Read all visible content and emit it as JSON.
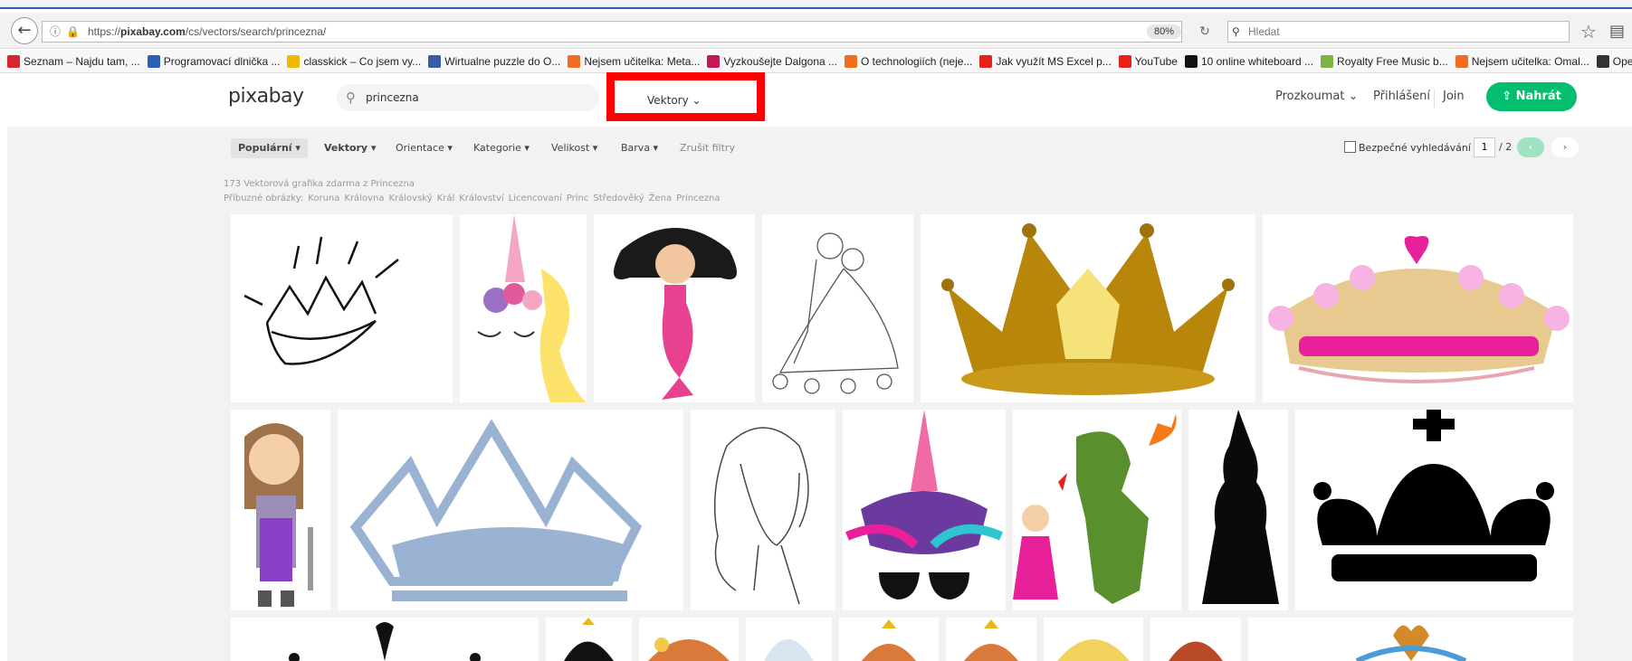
{
  "browser": {
    "url_prefix": "https://",
    "url_domain": "pixabay.com",
    "url_path": "/cs/vectors/search/princezna/",
    "zoom": "80%",
    "search_placeholder": "Hledat"
  },
  "bookmarks": [
    {
      "label": "Seznam – Najdu tam, ...",
      "color": "#d9232e"
    },
    {
      "label": "Programovací dlnička ...",
      "color": "#2b5fb4"
    },
    {
      "label": "classkick – Co jsem vy...",
      "color": "#f2b705"
    },
    {
      "label": "Wirtualne puzzle do O...",
      "color": "#3a5da8"
    },
    {
      "label": "Nejsem učitelka: Meta...",
      "color": "#f36d21"
    },
    {
      "label": "Vyzkoušejte Dalgona ...",
      "color": "#c2185b"
    },
    {
      "label": "O technologiích (neje...",
      "color": "#f36d21"
    },
    {
      "label": "Jak využít MS Excel p...",
      "color": "#e62117"
    },
    {
      "label": "YouTube",
      "color": "#e62117"
    },
    {
      "label": "10 online whiteboard ...",
      "color": "#111111"
    },
    {
      "label": "Royalty Free Music b...",
      "color": "#7cb342"
    },
    {
      "label": "Nejsem učitelka: Omal...",
      "color": "#f36d21"
    },
    {
      "label": "Open Broad",
      "color": "#333333"
    }
  ],
  "header": {
    "logo": "pixabay",
    "search_value": "princezna",
    "type_select": "Vektory",
    "explore": "Prozkoumat",
    "login": "Přihlášení",
    "join": "Join",
    "upload": "Nahrát"
  },
  "filters": {
    "popular": "Populární",
    "vectors": "Vektory",
    "orientation": "Orientace",
    "category": "Kategorie",
    "size": "Velikost",
    "color": "Barva",
    "clear": "Zrušit filtry",
    "safe_search": "Bezpečné vyhledávání",
    "page": "1",
    "page_total": "/ 2"
  },
  "results": {
    "count": "173 Vektorová grafika zdarma z Princezna",
    "related_label": "Příbuzné obrázky:",
    "related": [
      "Koruna",
      "Královna",
      "Královský",
      "Král",
      "Království",
      "Licencovaní",
      "Princ",
      "Středověký",
      "Žena",
      "Princezna"
    ]
  },
  "colors": {
    "accent": "#02be6e",
    "highlight_box": "#ff0000"
  }
}
